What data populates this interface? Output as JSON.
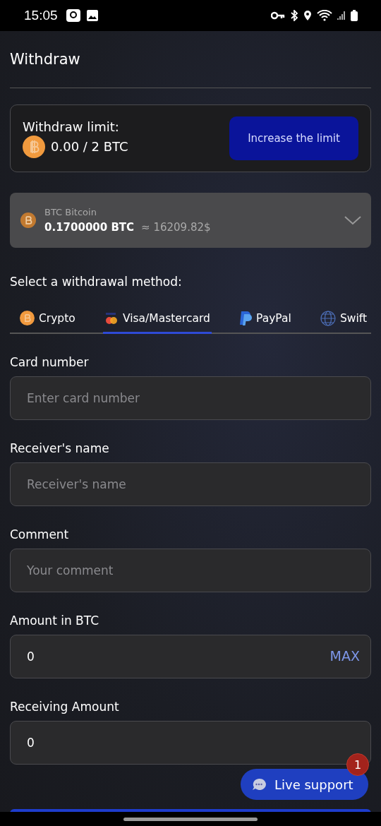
{
  "status_bar": {
    "time": "15:05"
  },
  "title": "Withdraw",
  "limit": {
    "label": "Withdraw limit:",
    "value": "0.00 / 2 BTC",
    "button": "Increase the limit"
  },
  "wallet": {
    "name": "BTC Bitcoin",
    "amount": "0.1700000 BTC",
    "approx": "≈ 16209.82$"
  },
  "method_heading": "Select a withdrawal method:",
  "tabs": [
    {
      "label": "Crypto",
      "kind": "crypto",
      "selected": false
    },
    {
      "label": "Visa/Mastercard",
      "kind": "card",
      "selected": true
    },
    {
      "label": "PayPal",
      "kind": "paypal",
      "selected": false
    },
    {
      "label": "Swift",
      "kind": "swift",
      "selected": false
    }
  ],
  "fields": [
    {
      "label": "Card number",
      "placeholder": "Enter card number"
    },
    {
      "label": "Receiver's name",
      "placeholder": "Receiver's name"
    },
    {
      "label": "Comment",
      "placeholder": "Your comment"
    },
    {
      "label": "Amount in BTC",
      "value": "0",
      "action": "MAX"
    },
    {
      "label": "Receiving Amount",
      "value": "0"
    }
  ],
  "live_support": {
    "label": "Live support",
    "badge": "1"
  }
}
